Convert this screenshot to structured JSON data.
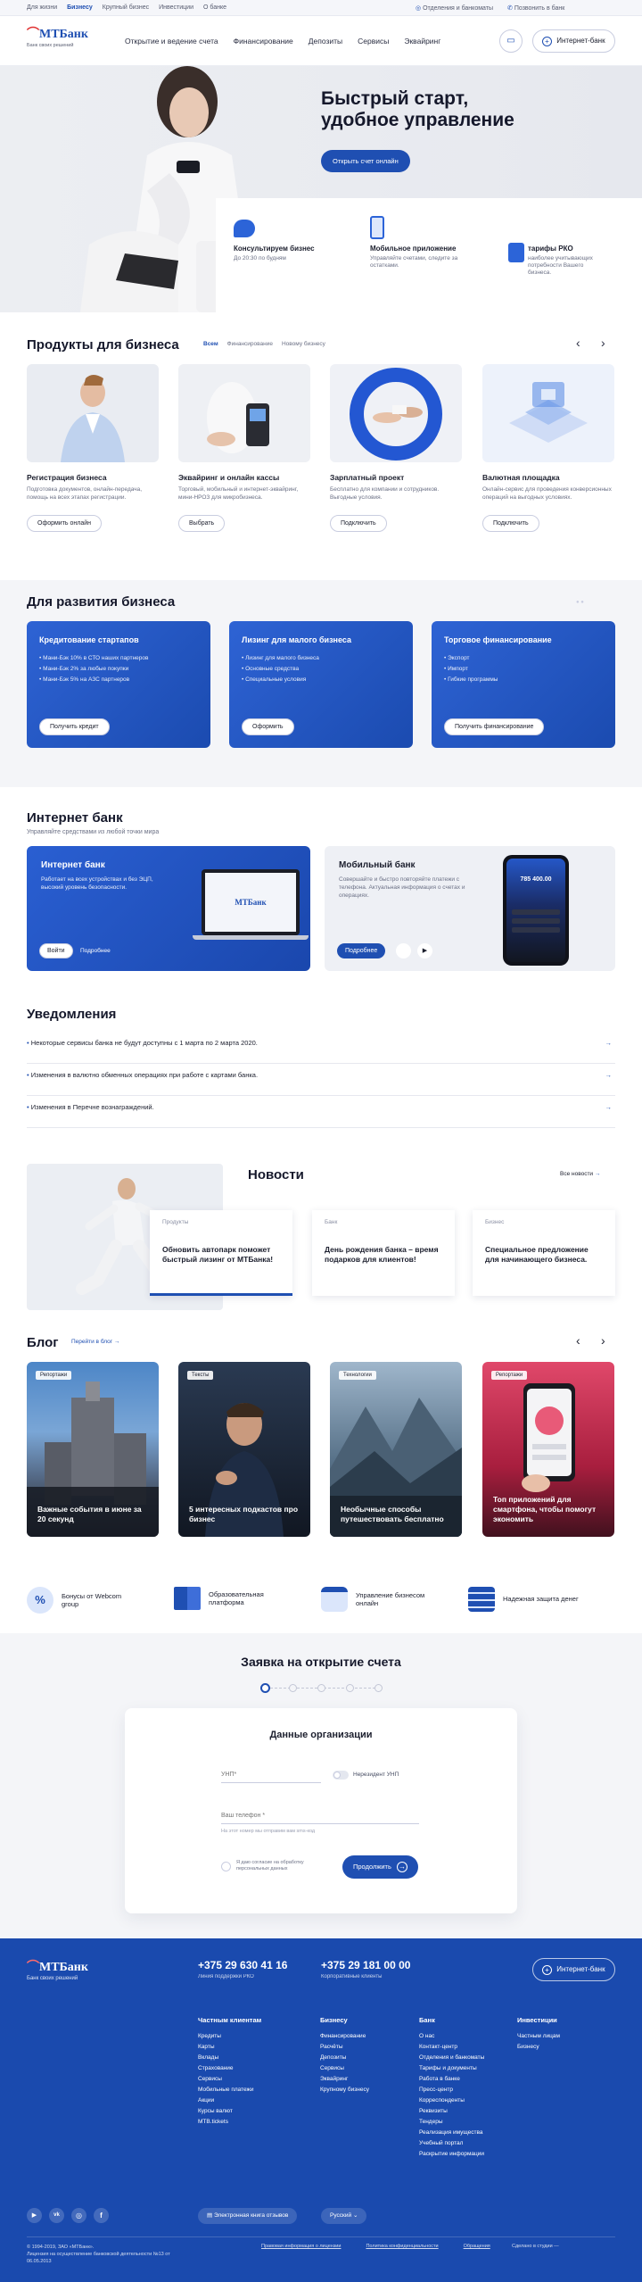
{
  "topbar": {
    "segments": [
      "Для жизни",
      "Бизнесу",
      "Крупный бизнес",
      "Инвестиции",
      "О банке"
    ],
    "offices": "Отделения и банкоматы",
    "call": "Позвонить в банк"
  },
  "header": {
    "logo": "МТБанк",
    "logo_sub": "Банк своих решений",
    "nav": [
      "Открытие и ведение счета",
      "Финансирование",
      "Депозиты",
      "Сервисы",
      "Эквайринг"
    ],
    "internet_bank": "Интернет-банк"
  },
  "hero": {
    "title": "Быстрый старт, удобное управление",
    "cta": "Открыть счет онлайн",
    "features": [
      {
        "title": "Консультируем бизнес",
        "text": "До 20:30 по будням"
      },
      {
        "title": "Мобильное приложение",
        "text": "Управляйте счетами, следите за остатками."
      },
      {
        "title": "тарифы РКО",
        "text": "наиболее учитывающих потребности Вашего бизнеса."
      }
    ]
  },
  "products": {
    "title": "Продукты для бизнеса",
    "filters": [
      "Всем",
      "Финансирование",
      "Новому бизнесу"
    ],
    "items": [
      {
        "title": "Регистрация бизнеса",
        "text": "Подготовка документов, онлайн-передача, помощь на всех этапах регистрации.",
        "button": "Оформить онлайн"
      },
      {
        "title": "Эквайринг и онлайн кассы",
        "text": "Торговый, мобильный и интернет-эквайринг, мини-НРОЗ для микробизнеса.",
        "button": "Выбрать"
      },
      {
        "title": "Зарплатный проект",
        "text": "Бесплатно для компании и сотрудников. Выгодные условия.",
        "button": "Подключить"
      },
      {
        "title": "Валютная площадка",
        "text": "Онлайн-сервис для проведения конверсионных операций на выгодных условиях.",
        "button": "Подключить"
      }
    ]
  },
  "development": {
    "title": "Для развития бизнеса",
    "cards": [
      {
        "title": "Кредитование стартапов",
        "items": [
          "Мани-Бэк 10% в СТО наших партнеров",
          "Мани-Бэк 2% за любые покупки",
          "Мани-Бэк 5% на АЗС партнеров"
        ],
        "button": "Получить кредит"
      },
      {
        "title": "Лизинг для малого бизнеса",
        "items": [
          "Лизинг для малого бизнеса",
          "Основные средства",
          "Специальные условия"
        ],
        "button": "Оформить"
      },
      {
        "title": "Торговое финансирование",
        "items": [
          "Экспорт",
          "Импорт",
          "Гибкие программы"
        ],
        "button": "Получить финансирование"
      }
    ]
  },
  "ibank": {
    "title": "Интернет банк",
    "subtitle": "Управляйте средствами из любой точки мира",
    "card1": {
      "title": "Интернет банк",
      "text": "Работает на всех устройствах и без ЭЦП, высокий уровень безопасности.",
      "login": "Войти",
      "more": "Подробнее",
      "screen_logo": "МТБанк"
    },
    "card2": {
      "title": "Мобильный банк",
      "text": "Совершайте и быстро повторяйте платежи с телефона. Актуальная информация о счетах и операциях.",
      "more": "Подробнее",
      "phone_amount": "785 400.00"
    }
  },
  "notices": {
    "title": "Уведомления",
    "items": [
      "Некоторые сервисы банка не будут доступны с 1 марта по 2 марта 2020.",
      "Изменения в валютно обменных операциях при работе с картами банка.",
      "Изменения в Перечне вознаграждений."
    ]
  },
  "news": {
    "title": "Новости",
    "all": "Все новости",
    "items": [
      {
        "tag": "Продукты",
        "title": "Обновить автопарк поможет быстрый лизинг от МТБанка!"
      },
      {
        "tag": "Банк",
        "title": "День рождения банка – время подарков для клиентов!"
      },
      {
        "tag": "Бизнес",
        "title": "Специальное предложение для начинающего бизнеса."
      }
    ]
  },
  "blog": {
    "title": "Блог",
    "link": "Перейти в блог",
    "items": [
      {
        "tag": "Репортажи",
        "title": "Важные события в июне за 20 секунд"
      },
      {
        "tag": "Тексты",
        "title": "5 интересных подкастов про бизнес"
      },
      {
        "tag": "Технологии",
        "title": "Необычные способы путешествовать бесплатно"
      },
      {
        "tag": "Репортажи",
        "title": "Топ приложений для смартфона, чтобы помогут экономить"
      }
    ]
  },
  "services": [
    {
      "label": "Бонусы от Webcom group"
    },
    {
      "label": "Образовательная платформа"
    },
    {
      "label": "Управление бизнесом онлайн"
    },
    {
      "label": "Надежная защита денег"
    }
  ],
  "application": {
    "title": "Заявка на открытие счета",
    "form_title": "Данные организации",
    "unp_placeholder": "УНП*",
    "nonres_label": "Нерезидент УНП",
    "phone_placeholder": "Ваш телефон *",
    "phone_hint": "На этот номер мы отправим вам sms-код",
    "agree": "Я даю согласие на обработку персональных данных",
    "submit": "Продолжить"
  },
  "footer": {
    "logo": "МТБанк",
    "logo_sub": "Банк своих решений",
    "phone1": "+375 29 630 41 16",
    "phone1_note": "Линия поддержки РКО",
    "phone2": "+375 29 181 00 00",
    "phone2_note": "Корпоративные клиенты",
    "internet_bank": "Интернет-банк",
    "columns": [
      {
        "title": "Частным клиентам",
        "links": [
          "Кредиты",
          "Карты",
          "Вклады",
          "Страхование",
          "Сервисы",
          "Мобильные платежи",
          "Акции",
          "Курсы валют",
          "MTB.tickets"
        ]
      },
      {
        "title": "Бизнесу",
        "links": [
          "Финансирование",
          "Расчёты",
          "Депозиты",
          "Сервисы",
          "Эквайринг",
          "Крупному бизнесу"
        ]
      },
      {
        "title": "Банк",
        "links": [
          "О нас",
          "Контакт-центр",
          "Отделения и банкоматы",
          "Тарифы и документы",
          "Работа в банке",
          "Пресс-центр",
          "Корреспонденты",
          "Реквизиты",
          "Тендеры",
          "Реализация имущества",
          "Учебный портал",
          "Раскрытие информации"
        ]
      },
      {
        "title": "Инвестиции",
        "links": [
          "Частным лицам",
          "Бизнесу"
        ]
      }
    ],
    "review_book": "Электронная книга отзывов",
    "lang": "Русский",
    "copyright": "© 1994-2019, ЗАО «МТБанк».",
    "license": "Лицензия на осуществление банковской деятельности №13 от 06.05.2013",
    "legal": [
      "Правовая информация о лицензии",
      "Политика конфиденциальности",
      "Обращения"
    ],
    "dev": "Сделано в студии —",
    "socials": [
      "youtube-icon",
      "vk-icon",
      "instagram-icon",
      "facebook-icon"
    ]
  }
}
